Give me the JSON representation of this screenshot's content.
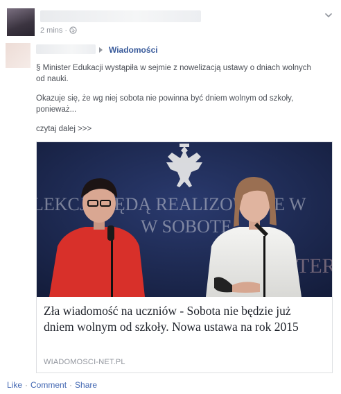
{
  "post": {
    "timestamp": "2 mins",
    "separator": "·"
  },
  "shared_post": {
    "group_name": "Wiadomości",
    "paragraph1": "§ Minister Edukacji wystąpiła w sejmie z nowelizacją ustawy o dniach wolnych od nauki.",
    "paragraph2": "Okazuje się, że wg niej sobota nie powinna być dniem wolnym od szkoły, ponieważ...",
    "read_more": "czytaj dalej >>>"
  },
  "link_card": {
    "headline": "Zła wiadomość na uczniów - Sobota nie będzie już dniem wolnym od szkoły. Nowa ustawa na rok 2015",
    "domain": "WIADOMOSCI-NET.PL",
    "image_banner_line1": "LEKCJE BĘDĄ REALIZOWANE W",
    "image_banner_line2": "W SOBOTĘ",
    "image_banner_line3": "MINISTERSTWO"
  },
  "actions": {
    "like": "Like",
    "comment": "Comment",
    "share": "Share",
    "separator": "·"
  },
  "colors": {
    "link_blue": "#365899",
    "meta_gray": "#90949c",
    "banner_navy": "#1b2a55"
  }
}
